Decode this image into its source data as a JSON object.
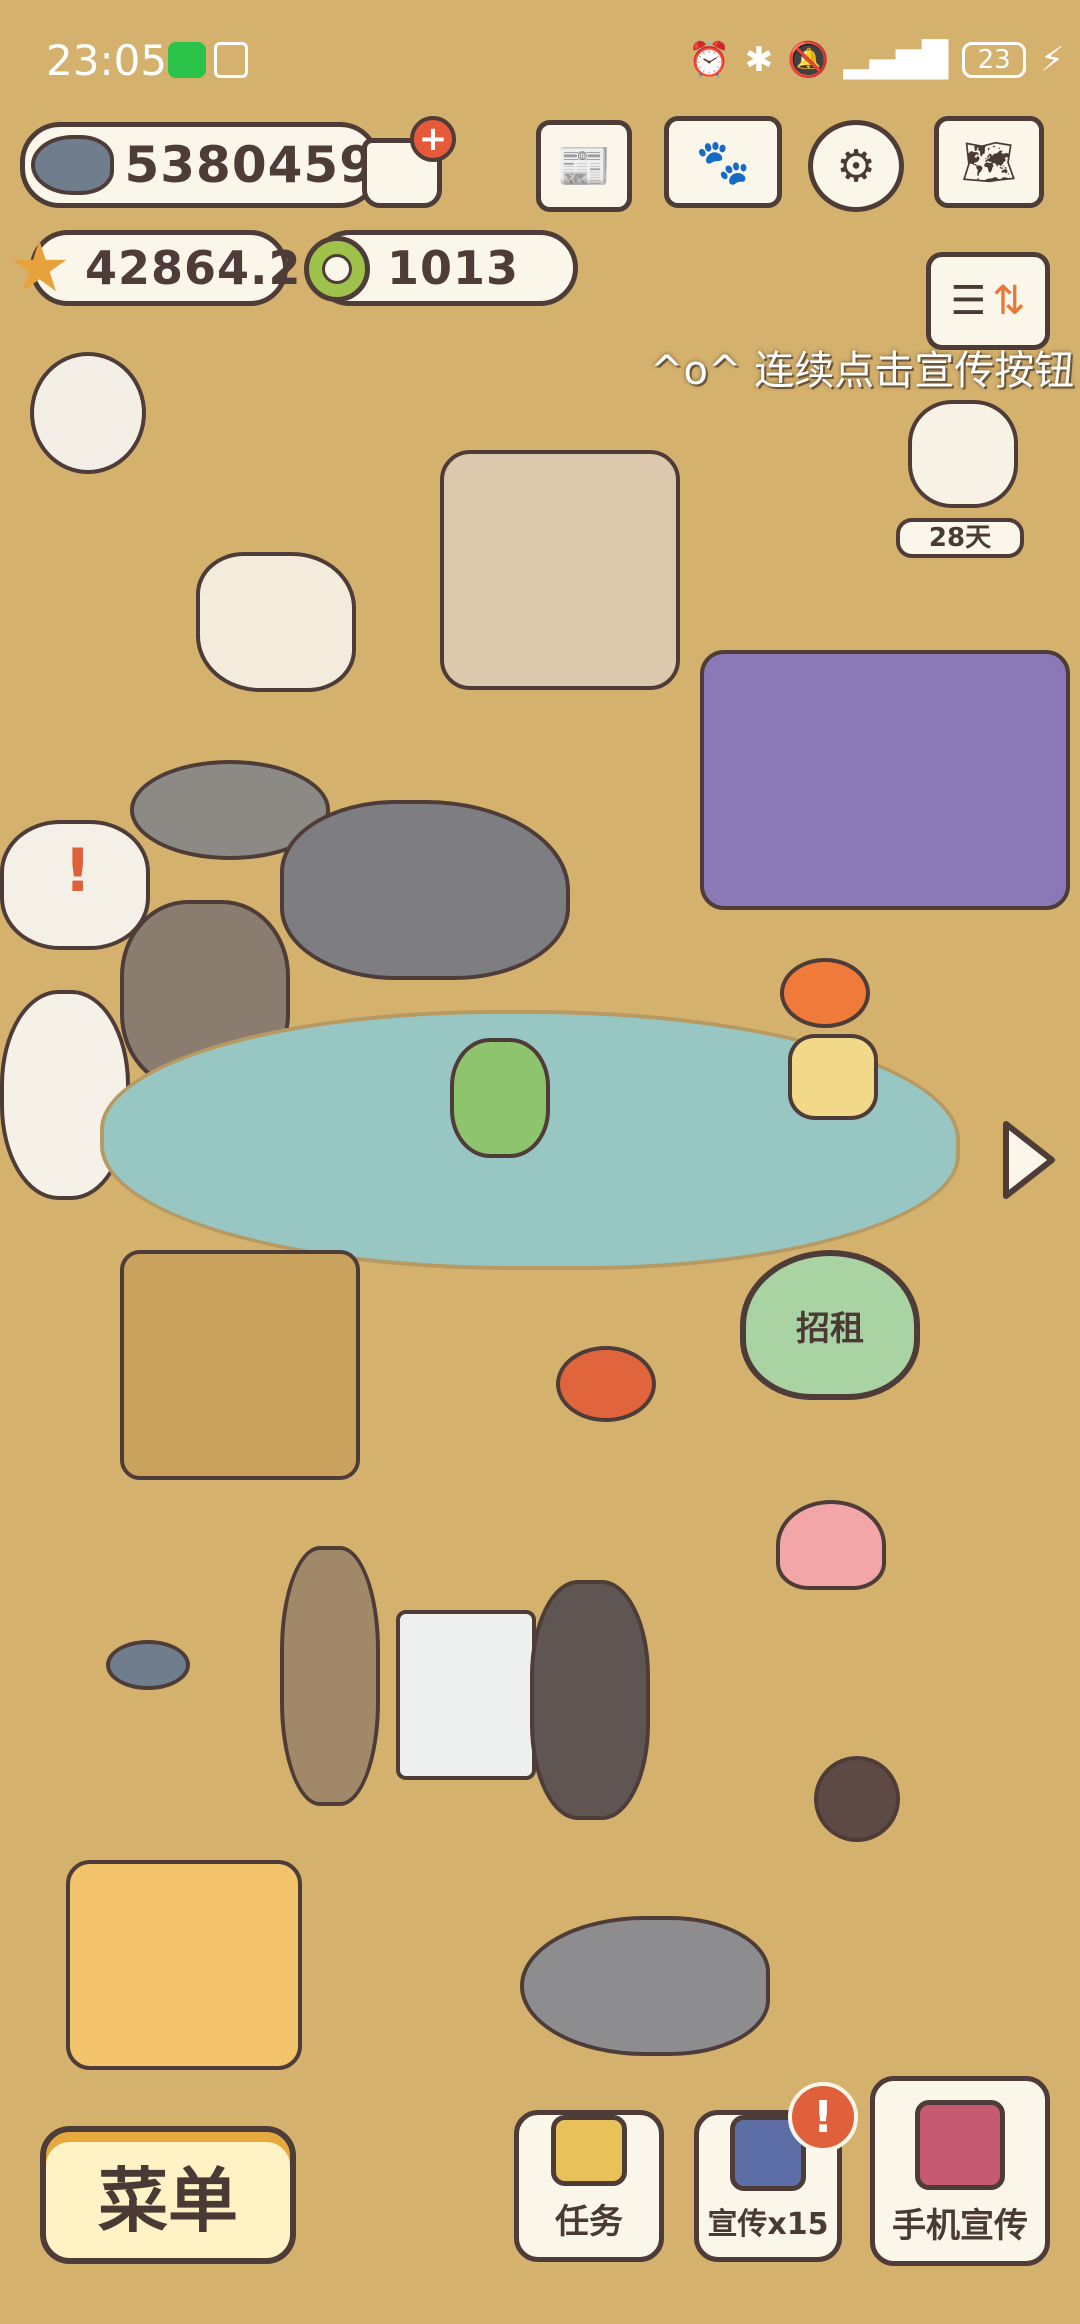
{
  "status_bar": {
    "time": "23:05",
    "battery": "23"
  },
  "currency": {
    "fish": "5380459",
    "stars": "42864.2",
    "rings": "1013"
  },
  "banner": {
    "marquee": "^o^ 连续点击宣传按钮"
  },
  "visitor": {
    "days_label": "28天"
  },
  "rent_sign": {
    "label": "招租"
  },
  "bottom_bar": {
    "menu_label": "菜单",
    "tasks_label": "任务",
    "promo_label": "宣传x15",
    "phone_promo_label": "手机宣传",
    "alert_badge": "!"
  },
  "colors": {
    "ground": "#d4b16d",
    "pond": "#98c6c2",
    "outline": "#4e3c38",
    "accent_orange": "#e0603c"
  },
  "icons": [
    "fish-icon",
    "cart-icon",
    "plus-icon",
    "newspaper-icon",
    "paw-book-icon",
    "gear-icon",
    "map-icon",
    "star-icon",
    "ring-icon",
    "sort-icon",
    "chevron-right-icon"
  ]
}
